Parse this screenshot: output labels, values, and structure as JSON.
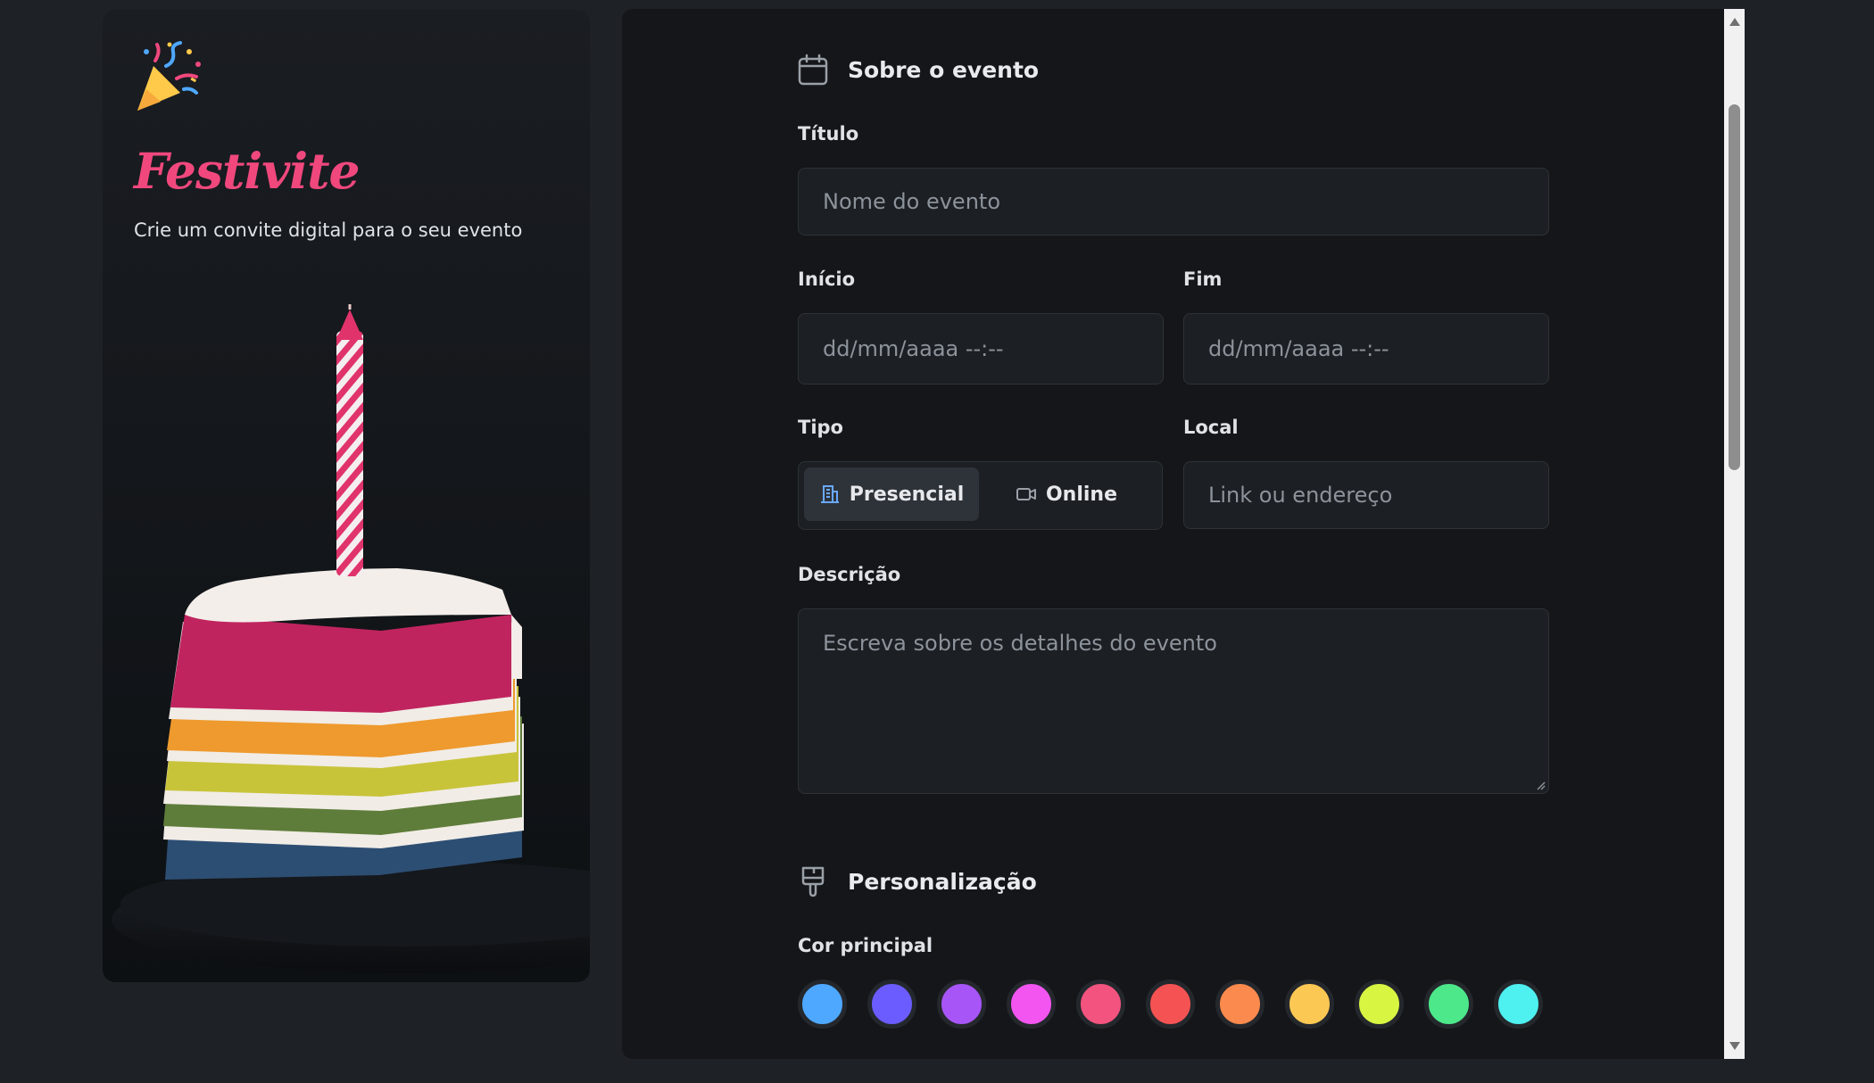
{
  "brand": {
    "name": "Festivite",
    "tagline": "Crie um convite digital para o seu evento",
    "accent_color": "#f0487d"
  },
  "about": {
    "section_title": "Sobre o evento",
    "section_icon": "calendar-icon",
    "title_label": "Título",
    "title_placeholder": "Nome do evento",
    "start_label": "Início",
    "start_placeholder": "dd/mm/aaaa --:--",
    "end_label": "Fim",
    "end_placeholder": "dd/mm/aaaa --:--",
    "type_label": "Tipo",
    "type_options": [
      {
        "label": "Presencial",
        "icon": "building-icon",
        "selected": true
      },
      {
        "label": "Online",
        "icon": "video-icon",
        "selected": false
      }
    ],
    "location_label": "Local",
    "location_placeholder": "Link ou endereço",
    "description_label": "Descrição",
    "description_placeholder": "Escreva sobre os detalhes do evento"
  },
  "customization": {
    "section_title": "Personalização",
    "section_icon": "paintbrush-icon",
    "main_color_label": "Cor principal",
    "colors": [
      "#4ea8ff",
      "#6b5cff",
      "#a855f7",
      "#f255f0",
      "#f2547f",
      "#f55353",
      "#fa8a4d",
      "#fcc854",
      "#d8f542",
      "#4ce88a",
      "#4ef0f0"
    ]
  }
}
